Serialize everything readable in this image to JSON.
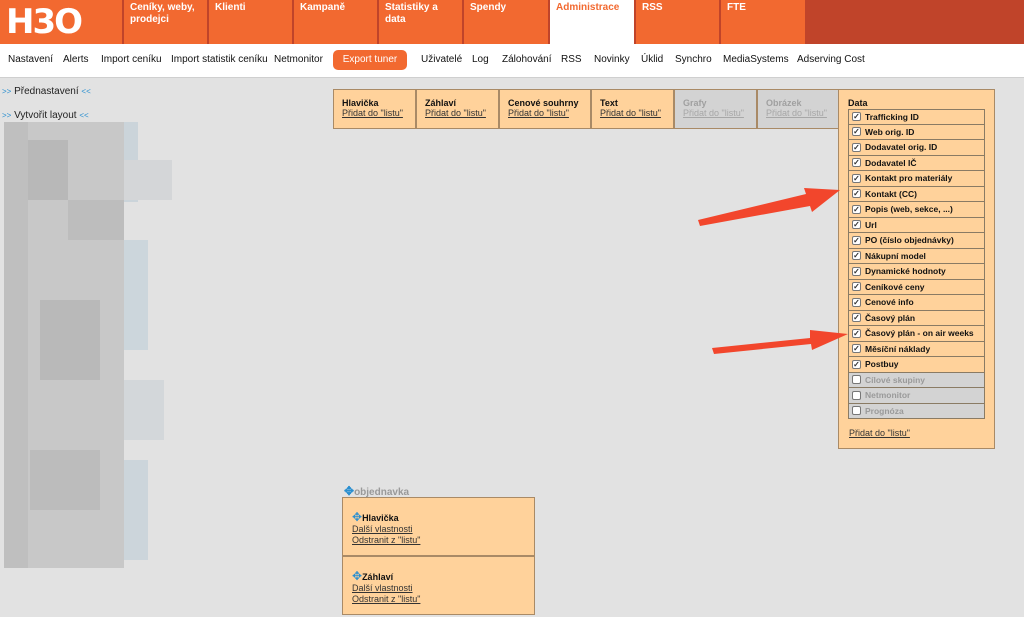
{
  "logo": "H3O",
  "main_tabs": [
    {
      "label": "Ceníky, weby, prodejci"
    },
    {
      "label": "Klienti"
    },
    {
      "label": "Kampaně"
    },
    {
      "label": "Statistiky a data"
    },
    {
      "label": "Spendy"
    },
    {
      "label": "Administrace"
    },
    {
      "label": "RSS"
    },
    {
      "label": "FTE"
    }
  ],
  "sub_nav": [
    {
      "label": "Nastavení"
    },
    {
      "label": "Alerts"
    },
    {
      "label": "Import ceníku"
    },
    {
      "label": "Import statistik ceníku"
    },
    {
      "label": "Netmonitor"
    },
    {
      "label": "Export tuner"
    },
    {
      "label": "Uživatelé"
    },
    {
      "label": "Log"
    },
    {
      "label": "Zálohování"
    },
    {
      "label": "RSS"
    },
    {
      "label": "Novinky"
    },
    {
      "label": "Úklid"
    },
    {
      "label": "Synchro"
    },
    {
      "label": "MediaSystems"
    },
    {
      "label": "Adserving Cost"
    }
  ],
  "left": {
    "preset_label": "Přednastavení",
    "create_layout_label": "Vytvořit layout",
    "arrow_right": ">>",
    "arrow_left": "<<"
  },
  "blocks": [
    {
      "title": "Hlavička",
      "link": "Přidat do \"listu\""
    },
    {
      "title": "Záhlaví",
      "link": "Přidat do \"listu\""
    },
    {
      "title": "Cenové souhrny",
      "link": "Přidat do \"listu\""
    },
    {
      "title": "Text",
      "link": "Přidat do \"listu\""
    },
    {
      "title": "Grafy",
      "link": "Přidat do \"listu\""
    },
    {
      "title": "Obrázek",
      "link": "Přidat do \"listu\""
    }
  ],
  "data_panel": {
    "title": "Data",
    "items": [
      {
        "label": "Trafficking ID",
        "checked": true
      },
      {
        "label": "Web orig. ID",
        "checked": true
      },
      {
        "label": "Dodavatel orig. ID",
        "checked": true
      },
      {
        "label": "Dodavatel IČ",
        "checked": true
      },
      {
        "label": "Kontakt pro materiály",
        "checked": true
      },
      {
        "label": "Kontakt (CC)",
        "checked": true
      },
      {
        "label": "Popis (web, sekce, ...)",
        "checked": true
      },
      {
        "label": "Url",
        "checked": true
      },
      {
        "label": "PO (číslo objednávky)",
        "checked": true
      },
      {
        "label": "Nákupní model",
        "checked": true
      },
      {
        "label": "Dynamické hodnoty",
        "checked": true
      },
      {
        "label": "Ceníkové ceny",
        "checked": true
      },
      {
        "label": "Cenové info",
        "checked": true
      },
      {
        "label": "Časový plán",
        "checked": true
      },
      {
        "label": "Časový plán - on air weeks",
        "checked": true
      },
      {
        "label": "Měsíční náklady",
        "checked": true
      },
      {
        "label": "Postbuy",
        "checked": true
      },
      {
        "label": "Cílové skupiny",
        "checked": false
      },
      {
        "label": "Netmonitor",
        "checked": false
      },
      {
        "label": "Prognóza",
        "checked": false
      }
    ],
    "add_link": "Přidat do \"listu\""
  },
  "layout": {
    "name": "objednavka",
    "items": [
      {
        "title": "Hlavička",
        "props": "Další vlastnosti",
        "remove": "Odstranit z \"listu\""
      },
      {
        "title": "Záhlaví",
        "props": "Další vlastnosti",
        "remove": "Odstranit z \"listu\""
      }
    ]
  },
  "colors": {
    "brand": "#f26930",
    "panel": "#ffd29b",
    "arrow": "#f2462c"
  }
}
